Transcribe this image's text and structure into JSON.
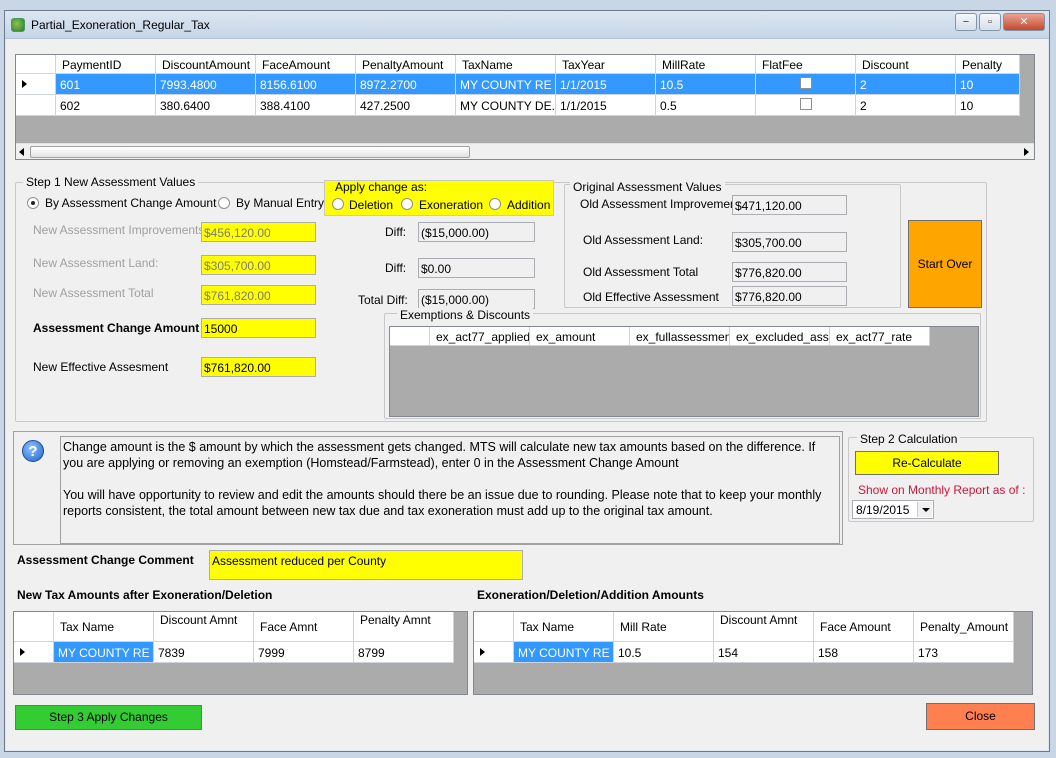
{
  "window": {
    "title": "Partial_Exoneration_Regular_Tax",
    "minimize": "−",
    "restore": "▫",
    "close": "✕"
  },
  "payments_grid": {
    "columns": [
      "PaymentID",
      "DiscountAmount",
      "FaceAmount",
      "PenaltyAmount",
      "TaxName",
      "TaxYear",
      "MillRate",
      "FlatFee",
      "Discount",
      "Penalty"
    ],
    "rows": [
      [
        "601",
        "7993.4800",
        "8156.6100",
        "8972.2700",
        "MY COUNTY  RE",
        "1/1/2015",
        "10.5",
        "",
        "2",
        "10"
      ],
      [
        "602",
        "380.6400",
        "388.4100",
        "427.2500",
        "MY COUNTY DE...",
        "1/1/2015",
        "0.5",
        "",
        "2",
        "10"
      ]
    ],
    "selected_row": 0
  },
  "step1": {
    "title": "Step 1   New Assessment Values",
    "radio_change_amount": "By Assessment Change Amount",
    "radio_manual": "By Manual Entry",
    "improvements_label": "New Assessment Improvements:",
    "improvements_value": "$456,120.00",
    "land_label": "New Assessment Land:",
    "land_value": "$305,700.00",
    "total_label": "New Assessment Total",
    "total_value": "$761,820.00",
    "change_label": "Assessment Change Amount",
    "change_value": "15000",
    "effective_label": "New Effective Assesment",
    "effective_value": "$761,820.00"
  },
  "apply_change": {
    "title": "Apply change as:",
    "deletion": "Deletion",
    "exoneration": "Exoneration",
    "addition": "Addition"
  },
  "diffs": {
    "diff1_label": "Diff:",
    "diff1_value": "($15,000.00)",
    "diff2_label": "Diff:",
    "diff2_value": "$0.00",
    "total_label": "Total Diff:",
    "total_value": "($15,000.00)"
  },
  "original": {
    "title": "Original Assessment Values",
    "improvements_label": "Old Assessment Improvements:",
    "improvements_value": "$471,120.00",
    "land_label": "Old Assessment Land:",
    "land_value": "$305,700.00",
    "total_label": "Old Assessment Total",
    "total_value": "$776,820.00",
    "effective_label": "Old Effective Assessment",
    "effective_value": "$776,820.00"
  },
  "start_over": "Start Over",
  "exemptions": {
    "title": "Exemptions & Discounts",
    "columns": [
      "ex_act77_applied",
      "ex_amount",
      "ex_fullassessment",
      "ex_excluded_asses",
      "ex_act77_rate"
    ]
  },
  "info": {
    "p1": "Change amount is the $ amount by which the assessment gets changed.  MTS will calculate new tax amounts based on the difference. If you are applying or removing an exemption (Homstead/Farmstead), enter 0  in the Assessment Change Amount",
    "p2": "You will have  opportunity to review and edit the amounts should there be an issue due to rounding. Please note that to keep your monthly reports consistent, the total amount between new tax due and tax exoneration must add up to the original tax amount."
  },
  "step2": {
    "title": "Step 2    Calculation",
    "recalc": "Re-Calculate",
    "report_label": "Show on Monthly Report as of :",
    "report_date": "8/19/2015"
  },
  "comment": {
    "label": "Assessment Change Comment",
    "value": "Assessment reduced per County"
  },
  "new_tax": {
    "title": "New Tax Amounts after Exoneration/Deletion",
    "columns": [
      "Tax Name",
      "Discount Amnt",
      "Face Amnt",
      "Penalty Amnt"
    ],
    "row": [
      "MY COUNTY  RE",
      "7839",
      "7999",
      "8799"
    ]
  },
  "exo_amounts": {
    "title": "Exoneration/Deletion/Addition Amounts",
    "columns": [
      "Tax Name",
      "Mill Rate",
      "Discount Amnt",
      "Face Amount",
      "Penalty_Amount"
    ],
    "row": [
      "MY COUNTY  RE",
      "10.5",
      "154",
      "158",
      "173"
    ]
  },
  "step3": "Step 3    Apply Changes",
  "close": "Close",
  "colors": {
    "selected": "#3399ff",
    "yellow": "#ffff00",
    "orange": "#ffa500",
    "green": "#33cc33",
    "salmon": "#ff7f50"
  }
}
